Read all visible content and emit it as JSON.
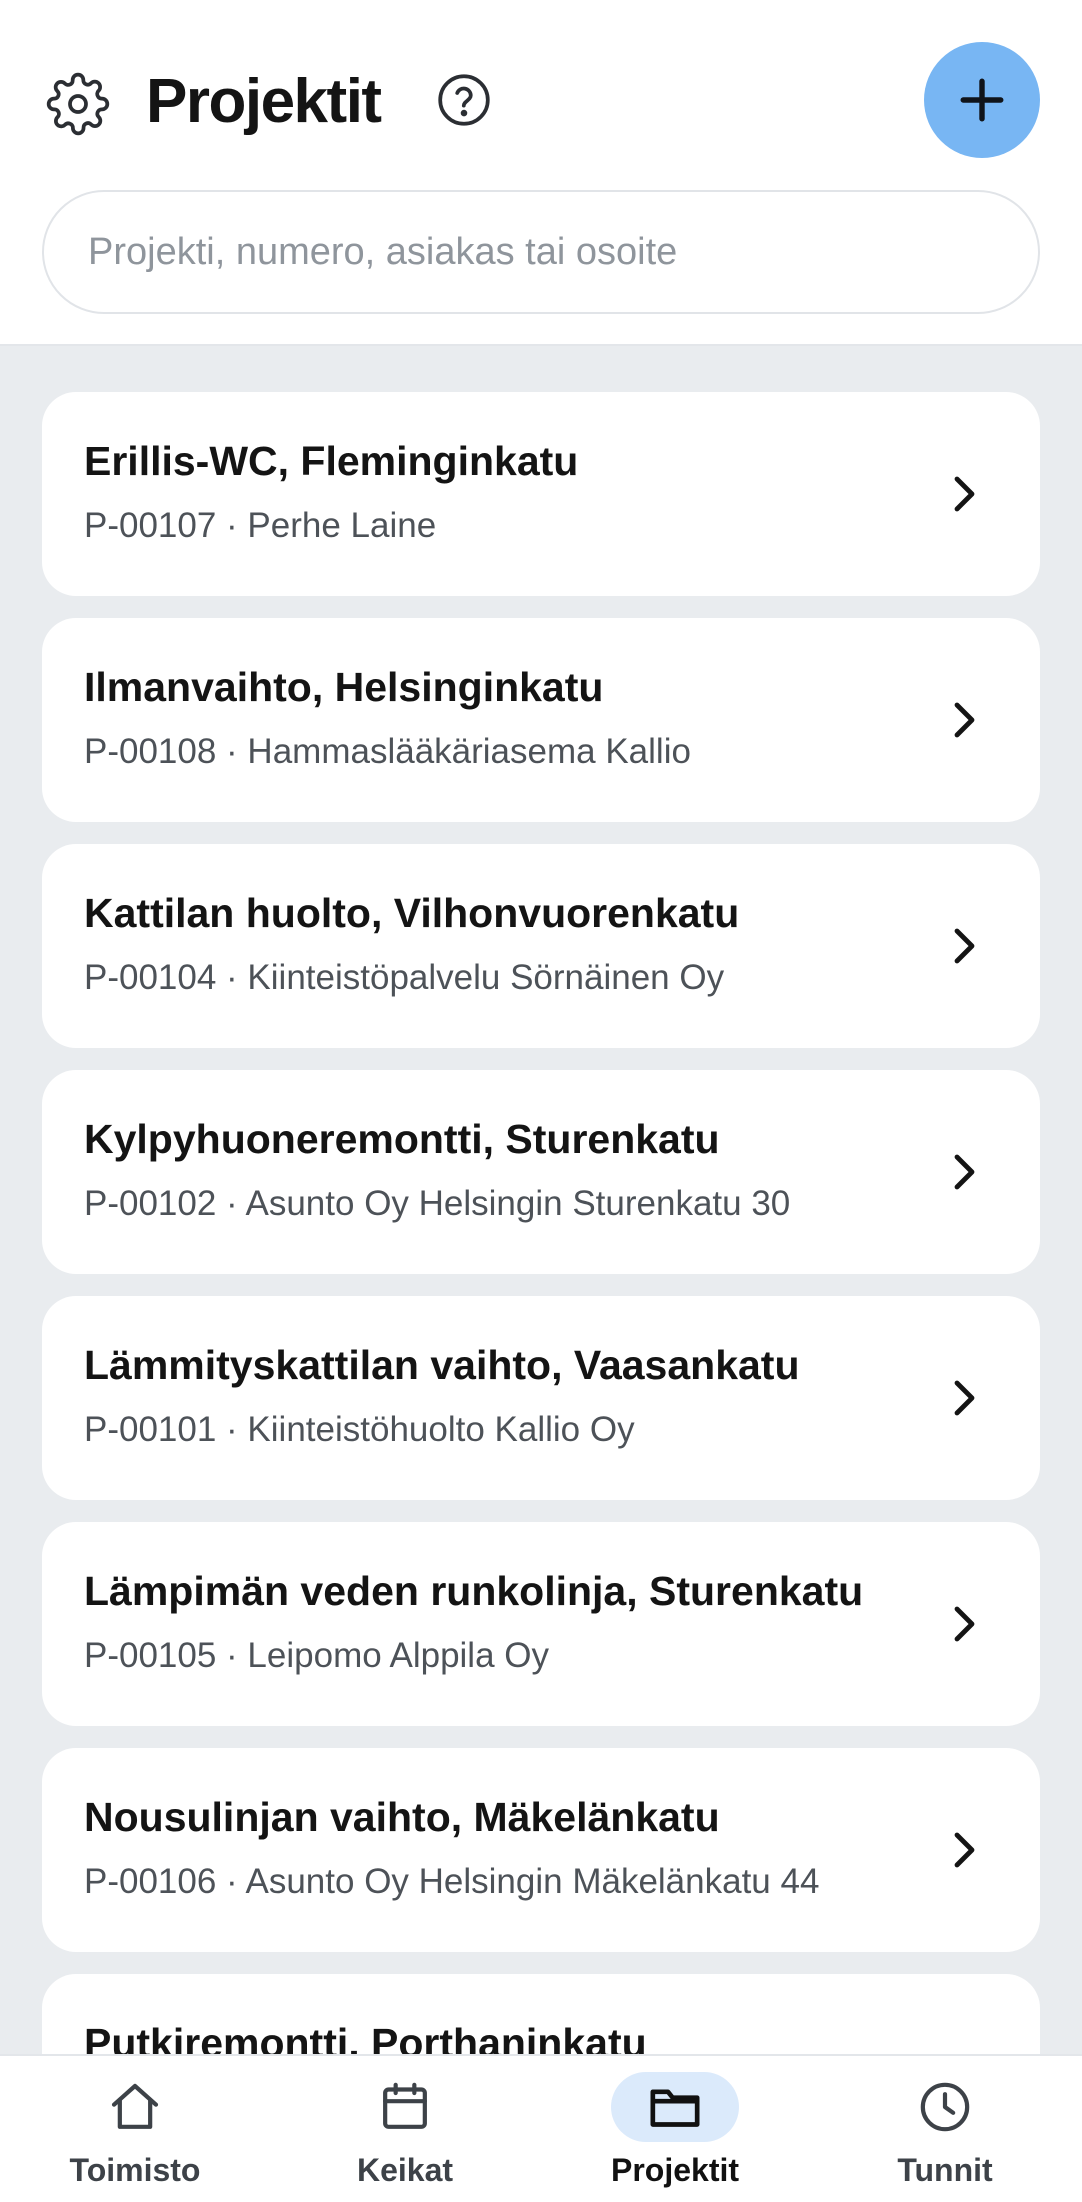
{
  "header": {
    "title": "Projektit",
    "settings_icon": "gear-icon",
    "help_icon": "help-icon",
    "add_icon": "plus-icon",
    "add_button_color": "#78b6f3"
  },
  "search": {
    "placeholder": "Projekti, numero, asiakas tai osoite",
    "value": ""
  },
  "projects": [
    {
      "title": "Erillis-WC, Fleminginkatu",
      "subtitle": "P-00107 · Perhe Laine"
    },
    {
      "title": "Ilmanvaihto, Helsinginkatu",
      "subtitle": "P-00108 · Hammaslääkäriasema Kallio"
    },
    {
      "title": "Kattilan huolto, Vilhonvuorenkatu",
      "subtitle": "P-00104 · Kiinteistöpalvelu Sörnäinen Oy"
    },
    {
      "title": "Kylpyhuoneremontti, Sturenkatu",
      "subtitle": "P-00102 · Asunto Oy Helsingin Sturenkatu 30"
    },
    {
      "title": "Lämmityskattilan vaihto, Vaasankatu",
      "subtitle": "P-00101 · Kiinteistöhuolto Kallio Oy"
    },
    {
      "title": "Lämpimän veden runkolinja, Sturenkatu",
      "subtitle": "P-00105 · Leipomo Alppila Oy"
    },
    {
      "title": "Nousulinjan vaihto, Mäkelänkatu",
      "subtitle": "P-00106 · Asunto Oy Helsingin Mäkelänkatu 44"
    },
    {
      "title": "Putkiremontti, Porthaninkatu",
      "subtitle": ""
    }
  ],
  "tabbar": {
    "tabs": [
      {
        "label": "Toimisto",
        "icon": "home-icon"
      },
      {
        "label": "Keikat",
        "icon": "calendar-icon"
      },
      {
        "label": "Projektit",
        "icon": "folder-icon",
        "active": true
      },
      {
        "label": "Tunnit",
        "icon": "clock-icon"
      }
    ],
    "active_color": "#dbeafb"
  }
}
